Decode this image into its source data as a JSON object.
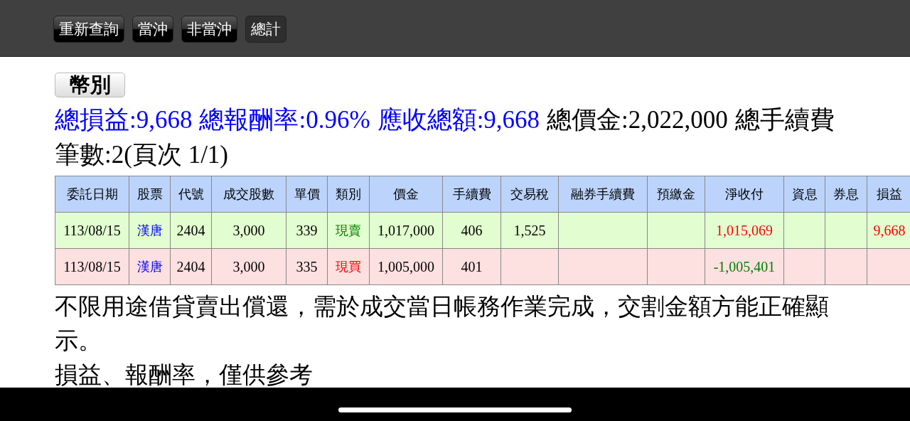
{
  "toolbar": {
    "buttons": [
      {
        "label": "重新查詢",
        "selected": false
      },
      {
        "label": "當沖",
        "selected": false
      },
      {
        "label": "非當沖",
        "selected": false
      },
      {
        "label": "總計",
        "selected": true
      }
    ]
  },
  "currency_button": "幣別",
  "summary": [
    {
      "text": "總損益:9,668",
      "color": "#0000ff"
    },
    {
      "text": "總報酬率:0.96%",
      "color": "#0000ff"
    },
    {
      "text": "應收總額:9,668",
      "color": "#0000ff"
    },
    {
      "text": "總價金:2,022,000",
      "color": "#000000"
    },
    {
      "text": "總手續費",
      "color": "#000000"
    }
  ],
  "record_count": "筆數:2(頁次 1/1)",
  "table": {
    "columns": [
      "委託日期",
      "股票",
      "代號",
      "成交股數",
      "單價",
      "類別",
      "價金",
      "手續費",
      "交易稅",
      "融券手續費",
      "預繳金",
      "淨收付",
      "資息",
      "券息",
      "損益"
    ],
    "rows": [
      {
        "kind": "sell",
        "cells": [
          "113/08/15",
          "漢唐",
          "2404",
          "3,000",
          "339",
          "現賣",
          "1,017,000",
          "406",
          "1,525",
          null,
          null,
          "1,015,069",
          null,
          null,
          "9,668"
        ]
      },
      {
        "kind": "buy",
        "cells": [
          "113/08/15",
          "漢唐",
          "2404",
          "3,000",
          "335",
          "現買",
          "1,005,000",
          "401",
          null,
          null,
          null,
          "-1,005,401",
          null,
          null,
          null
        ]
      }
    ]
  },
  "notes": [
    "不限用途借貸賣出償還，需於成交當日帳務作業完成，交割金額方能正確顯示。",
    "損益、報酬率，僅供參考"
  ]
}
